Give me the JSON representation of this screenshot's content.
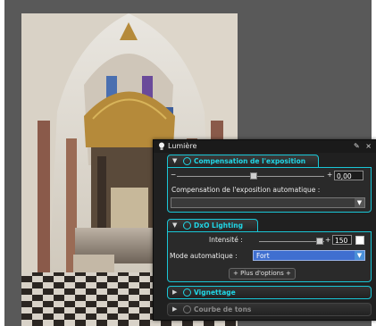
{
  "panel": {
    "title": "Lumière",
    "title_icons": "✎ ×"
  },
  "exposure": {
    "header": "Compensation de l'exposition",
    "minus": "−",
    "plus": "+",
    "value": "0,00",
    "auto_label": "Compensation de l'exposition automatique :",
    "auto_value": ""
  },
  "lighting": {
    "header": "DxO Lighting",
    "intensity_label": "Intensité :",
    "intensity_value": "150",
    "intensity_checked": false,
    "mode_label": "Mode automatique :",
    "mode_value": "Fort",
    "more_options": "+ Plus d'options +"
  },
  "collapsed_sections": [
    {
      "label": "Vignettage",
      "enabled": true
    },
    {
      "label": "Courbe de tons",
      "enabled": false
    }
  ],
  "colors": {
    "accent": "#20d6e6",
    "panel_bg": "#202020",
    "select_highlight": "#3f6fd0"
  },
  "icons": {
    "title": "light-bulb-icon",
    "section_toggle": "power-icon",
    "collapse": "triangle-down-icon",
    "expand": "triangle-right-icon",
    "dropdown": "chevron-down-icon"
  }
}
